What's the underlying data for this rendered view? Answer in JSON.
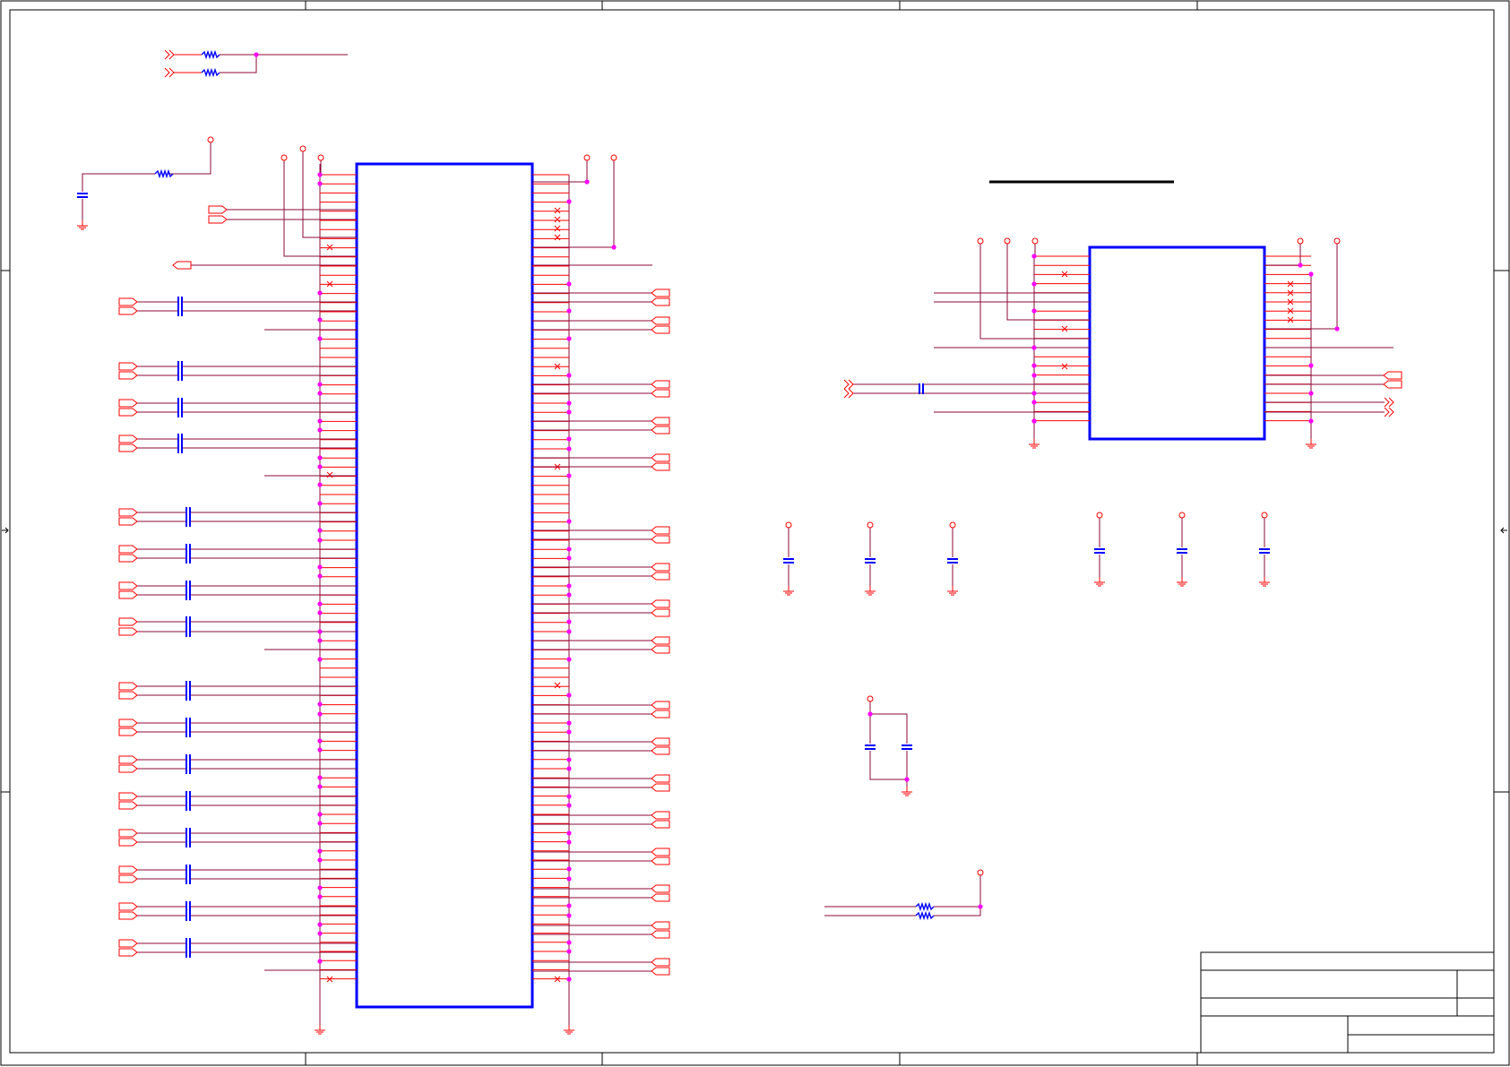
{
  "sheet": {
    "title_block_fields": [
      "",
      "",
      "",
      "",
      "",
      ""
    ]
  },
  "colors": {
    "wire": "#8b0a3a",
    "pin": "#ff0000",
    "component": "#0000ff",
    "chip_outline": "#0000ff",
    "junction": "#ff00ff",
    "border": "#000000"
  },
  "icons": {
    "power_port": "ring-on-stem",
    "ground": "ground-bars",
    "port": "pentagon-flag",
    "offpage": "double-chevron",
    "no_connect": "x-mark"
  }
}
